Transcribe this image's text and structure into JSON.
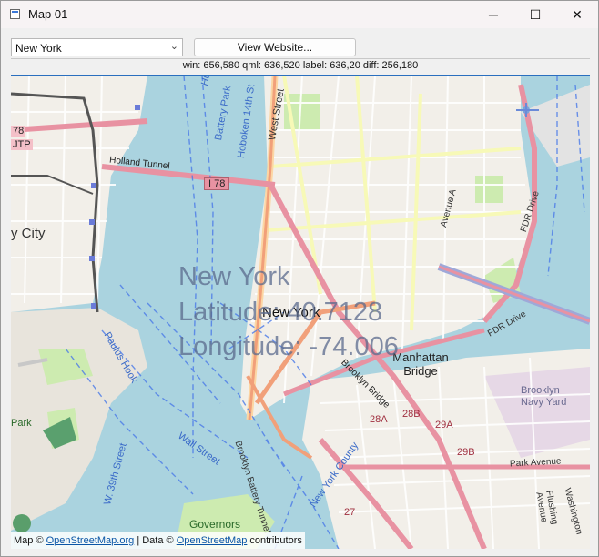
{
  "window": {
    "title": "Map 01",
    "minimize_glyph": "─",
    "maximize_glyph": "☐",
    "close_glyph": "✕"
  },
  "toolbar": {
    "city_select_value": "New York",
    "website_button": "View Website..."
  },
  "info": {
    "text": "win: 656,580  qml: 636,520 label: 636,20  diff: 256,180"
  },
  "map": {
    "overlay": {
      "city": "New York",
      "latitude": "Latitude: 40.7128",
      "longitude": "Longitude: -74.006"
    },
    "labels": {
      "hudson": "Hudson",
      "battery_park": "Battery Park",
      "hoboken": "Hoboken 14th St",
      "west_street": "West Street",
      "holland_tunnel": "Holland Tunnel",
      "i78_shield": "I 78",
      "i78_shield_small": "78",
      "jtp": "JTP",
      "jersey_city": "y City",
      "avenue_a": "Avenue A",
      "fdr_drive": "FDR Drive",
      "fdr_drive_2": "FDR Drive",
      "new_york_label": "New York",
      "manhattan_bridge": "Manhattan Bridge",
      "brooklyn_bridge": "Brooklyn Bridge",
      "brooklyn_navy_yard": "Brooklyn Navy Yard",
      "park_avenue": "Park Avenue",
      "washington": "Washington",
      "flushing": "Flushing Avenue",
      "wall_street": "Wall Street",
      "paulus_hook": "Paulus Hook",
      "w39": "W. 39th Street",
      "governors": "Governors",
      "battery_tunnel": "Brooklyn Battery Tunnel",
      "ny_county": "New York County",
      "park": "Park",
      "exit_28a": "28A",
      "exit_28b": "28B",
      "exit_29a": "29A",
      "exit_29b": "29B",
      "exit_27": "27"
    },
    "attribution": {
      "prefix": "Map ©",
      "osm_org": "OpenStreetMap.org",
      "middle": "| Data ©",
      "osm": "OpenStreetMap",
      "suffix": "contributors"
    }
  }
}
